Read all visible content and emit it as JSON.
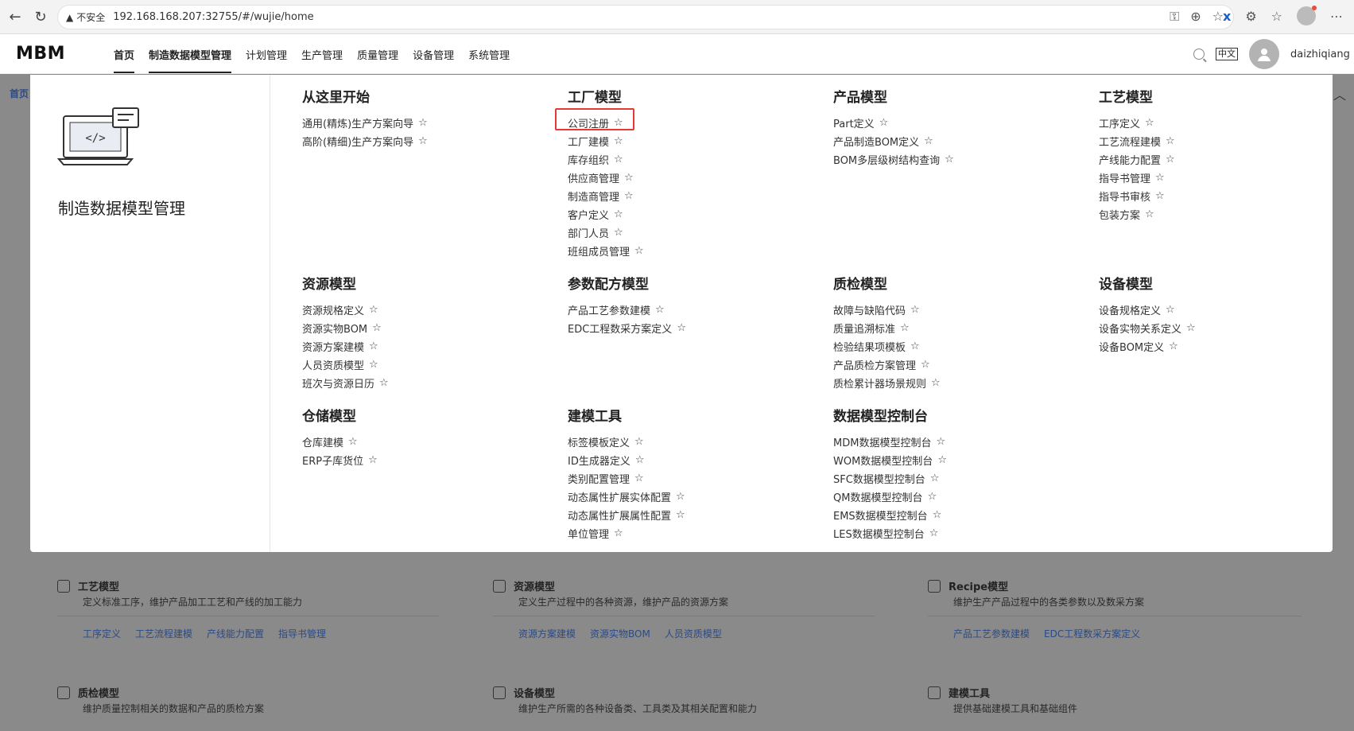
{
  "browser": {
    "security_label": "不安全",
    "url": "192.168.168.207:32755/#/wujie/home"
  },
  "header": {
    "logo": "MBM",
    "nav": [
      {
        "label": "首页"
      },
      {
        "label": "制造数据模型管理"
      },
      {
        "label": "计划管理"
      },
      {
        "label": "生产管理"
      },
      {
        "label": "质量管理"
      },
      {
        "label": "设备管理"
      },
      {
        "label": "系统管理"
      }
    ],
    "lang": "中文",
    "user": "daizhiqiang"
  },
  "breadcrumb": "首页",
  "mega": {
    "title": "制造数据模型管理",
    "groups": [
      {
        "title": "从这里开始",
        "links": [
          "通用(精炼)生产方案向导",
          "高阶(精细)生产方案向导"
        ]
      },
      {
        "title": "工厂模型",
        "links": [
          "公司注册",
          "工厂建模",
          "库存组织",
          "供应商管理",
          "制造商管理",
          "客户定义",
          "部门人员",
          "班组成员管理"
        ]
      },
      {
        "title": "产品模型",
        "links": [
          "Part定义",
          "产品制造BOM定义",
          "BOM多层级树结构查询"
        ]
      },
      {
        "title": "工艺模型",
        "links": [
          "工序定义",
          "工艺流程建模",
          "产线能力配置",
          "指导书管理",
          "指导书审核",
          "包装方案"
        ]
      },
      {
        "title": "资源模型",
        "links": [
          "资源规格定义",
          "资源实物BOM",
          "资源方案建模",
          "人员资质模型",
          "班次与资源日历"
        ]
      },
      {
        "title": "参数配方模型",
        "links": [
          "产品工艺参数建模",
          "EDC工程数采方案定义"
        ]
      },
      {
        "title": "质检模型",
        "links": [
          "故障与缺陷代码",
          "质量追溯标准",
          "检验结果项模板",
          "产品质检方案管理",
          "质检累计器场景规则"
        ]
      },
      {
        "title": "设备模型",
        "links": [
          "设备规格定义",
          "设备实物关系定义",
          "设备BOM定义"
        ]
      },
      {
        "title": "仓储模型",
        "links": [
          "仓库建模",
          "ERP子库货位"
        ]
      },
      {
        "title": "建模工具",
        "links": [
          "标签模板定义",
          "ID生成器定义",
          "类别配置管理",
          "动态属性扩展实体配置",
          "动态属性扩展属性配置",
          "单位管理"
        ]
      },
      {
        "title": "数据模型控制台",
        "links": [
          "MDM数据模型控制台",
          "WOM数据模型控制台",
          "SFC数据模型控制台",
          "QM数据模型控制台",
          "EMS数据模型控制台",
          "LES数据模型控制台"
        ]
      }
    ]
  },
  "cards": [
    {
      "title": "工艺模型",
      "desc": "定义标准工序，维护产品加工工艺和产线的加工能力",
      "links": [
        "工序定义",
        "工艺流程建模",
        "产线能力配置",
        "指导书管理"
      ],
      "icon": "process-icon"
    },
    {
      "title": "资源模型",
      "desc": "定义生产过程中的各种资源，维护产品的资源方案",
      "links": [
        "资源方案建模",
        "资源实物BOM",
        "人员资质模型"
      ],
      "icon": "layers-icon"
    },
    {
      "title": "Recipe模型",
      "desc": "维护生产产品过程中的各类参数以及数采方案",
      "links": [
        "产品工艺参数建模",
        "EDC工程数采方案定义"
      ],
      "icon": "recipe-icon"
    },
    {
      "title": "质检模型",
      "desc": "维护质量控制相关的数据和产品的质检方案",
      "links": [],
      "icon": "quality-icon"
    },
    {
      "title": "设备模型",
      "desc": "维护生产所需的各种设备类、工具类及其相关配置和能力",
      "links": [],
      "icon": "device-icon"
    },
    {
      "title": "建模工具",
      "desc": "提供基础建模工具和基础组件",
      "links": [],
      "icon": "tools-icon"
    }
  ]
}
